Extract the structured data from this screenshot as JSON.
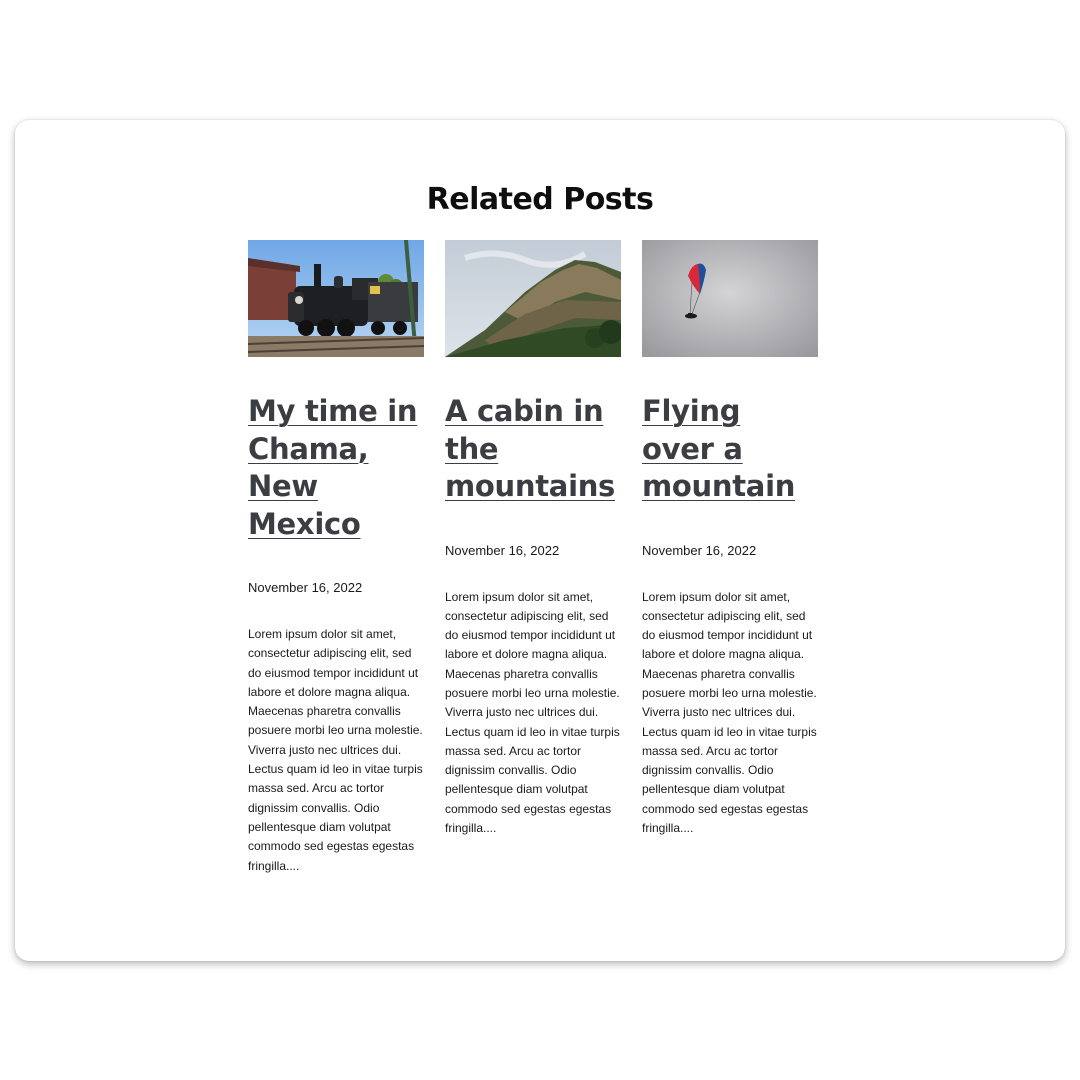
{
  "section": {
    "title": "Related Posts"
  },
  "posts": [
    {
      "image_subject": "steam locomotive at train station",
      "title": "My time in Chama, New Mexico",
      "date": "November 16, 2022",
      "excerpt": "Lorem ipsum dolor sit amet, consectetur adipiscing elit, sed do eiusmod tempor incididunt ut labore et dolore magna aliqua. Maecenas pharetra convallis posuere morbi leo urna molestie. Viverra justo nec ultrices dui. Lectus quam id leo in vitae turpis massa sed. Arcu ac tortor dignissim convallis. Odio pellentesque diam volutpat commodo sed egestas egestas fringilla...."
    },
    {
      "image_subject": "forested mountain slope under cloudy sky",
      "title": "A cabin in the mountains",
      "date": "November 16, 2022",
      "excerpt": "Lorem ipsum dolor sit amet, consectetur adipiscing elit, sed do eiusmod tempor incididunt ut labore et dolore magna aliqua. Maecenas pharetra convallis posuere morbi leo urna molestie. Viverra justo nec ultrices dui. Lectus quam id leo in vitae turpis massa sed. Arcu ac tortor dignissim convallis. Odio pellentesque diam volutpat commodo sed egestas egestas fringilla...."
    },
    {
      "image_subject": "paraglider in grey sky",
      "title": "Flying over a mountain",
      "date": "November 16, 2022",
      "excerpt": "Lorem ipsum dolor sit amet, consectetur adipiscing elit, sed do eiusmod tempor incididunt ut labore et dolore magna aliqua. Maecenas pharetra convallis posuere morbi leo urna molestie. Viverra justo nec ultrices dui. Lectus quam id leo in vitae turpis massa sed. Arcu ac tortor dignissim convallis. Odio pellentesque diam volutpat commodo sed egestas egestas fringilla...."
    }
  ],
  "colors": {
    "title_link": "#3b3d42",
    "text": "#1a1a1a",
    "heading": "#0e0e0e"
  }
}
